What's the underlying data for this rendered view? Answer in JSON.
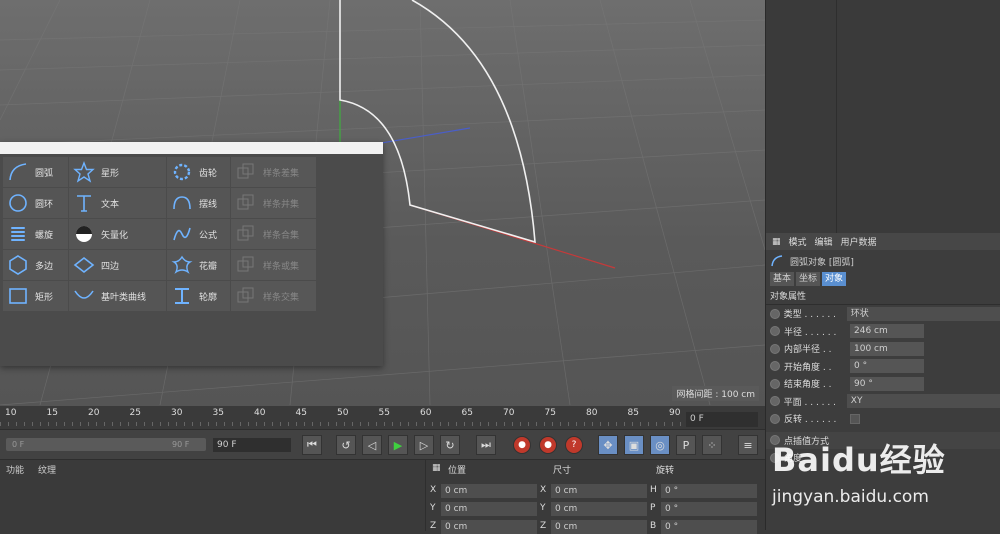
{
  "viewport": {
    "grid_spacing_label": "网格间距 : 100 cm"
  },
  "spline_menu": {
    "rows": [
      [
        {
          "label": "圆弧",
          "icon": "arc-icon",
          "enabled": true
        },
        {
          "label": "星形",
          "icon": "star-icon",
          "enabled": true
        },
        {
          "label": "齿轮",
          "icon": "gear-icon",
          "enabled": true
        },
        {
          "label": "样条差集",
          "icon": "spline-subtract-icon",
          "enabled": false
        }
      ],
      [
        {
          "label": "圆环",
          "icon": "circle-icon",
          "enabled": true
        },
        {
          "label": "文本",
          "icon": "text-icon",
          "enabled": true
        },
        {
          "label": "摆线",
          "icon": "cycloid-icon",
          "enabled": true
        },
        {
          "label": "样条并集",
          "icon": "spline-union-icon",
          "enabled": false
        }
      ],
      [
        {
          "label": "螺旋",
          "icon": "helix-icon",
          "enabled": true
        },
        {
          "label": "矢量化",
          "icon": "vectorize-icon",
          "enabled": true
        },
        {
          "label": "公式",
          "icon": "formula-icon",
          "enabled": true
        },
        {
          "label": "样条合集",
          "icon": "spline-and-icon",
          "enabled": false
        }
      ],
      [
        {
          "label": "多边",
          "icon": "polygon-icon",
          "enabled": true
        },
        {
          "label": "四边",
          "icon": "rhombus-icon",
          "enabled": true
        },
        {
          "label": "花瓣",
          "icon": "flower-icon",
          "enabled": true
        },
        {
          "label": "样条或集",
          "icon": "spline-or-icon",
          "enabled": false
        }
      ],
      [
        {
          "label": "矩形",
          "icon": "rectangle-icon",
          "enabled": true
        },
        {
          "label": "基叶类曲线",
          "icon": "cissoid-icon",
          "enabled": true
        },
        {
          "label": "轮廓",
          "icon": "profile-icon",
          "enabled": true
        },
        {
          "label": "样条交集",
          "icon": "spline-intersect-icon",
          "enabled": false
        }
      ]
    ]
  },
  "attributes": {
    "menu": [
      "模式",
      "编辑",
      "用户数据"
    ],
    "object_title": "圆弧对象 [圆弧]",
    "tabs": [
      {
        "label": "基本",
        "active": false
      },
      {
        "label": "坐标",
        "active": false
      },
      {
        "label": "对象",
        "active": true
      }
    ],
    "section": "对象属性",
    "props": [
      {
        "label": "类型 . . . . . .",
        "value": "环状",
        "wide": true
      },
      {
        "label": "半径 . . . . . .",
        "value": "246 cm",
        "wide": false
      },
      {
        "label": "内部半径 . .",
        "value": "100 cm",
        "wide": false
      },
      {
        "label": "开始角度 . .",
        "value": "0 °",
        "wide": false
      },
      {
        "label": "结束角度 . .",
        "value": "90 °",
        "wide": false
      },
      {
        "label": "平面 . . . . . .",
        "value": "XY",
        "wide": true
      },
      {
        "label": "反转 . . . . . .",
        "value": "",
        "wide": false
      }
    ],
    "interp_label": "点插值方式",
    "angle_label": "角度"
  },
  "timeline": {
    "ticks": [
      "10",
      "15",
      "20",
      "25",
      "30",
      "35",
      "40",
      "45",
      "50",
      "55",
      "60",
      "65",
      "70",
      "75",
      "80",
      "85",
      "90"
    ],
    "current_frame": "0 F"
  },
  "transport": {
    "slider_start": "0 F",
    "slider_end": "90 F",
    "end_frame": "90 F"
  },
  "bottom": {
    "tabs": [
      "功能",
      "纹理"
    ],
    "headers": {
      "position": "位置",
      "size": "尺寸",
      "rotation": "旋转"
    },
    "rows": [
      {
        "pa": "X",
        "pv": "0 cm",
        "sa": "X",
        "sv": "0 cm",
        "ra": "H",
        "rv": "0 °"
      },
      {
        "pa": "Y",
        "pv": "0 cm",
        "sa": "Y",
        "sv": "0 cm",
        "ra": "P",
        "rv": "0 °"
      },
      {
        "pa": "Z",
        "pv": "0 cm",
        "sa": "Z",
        "sv": "0 cm",
        "ra": "B",
        "rv": "0 °"
      }
    ]
  },
  "watermark": {
    "brand": "Baidu经验",
    "url": "jingyan.baidu.com"
  }
}
